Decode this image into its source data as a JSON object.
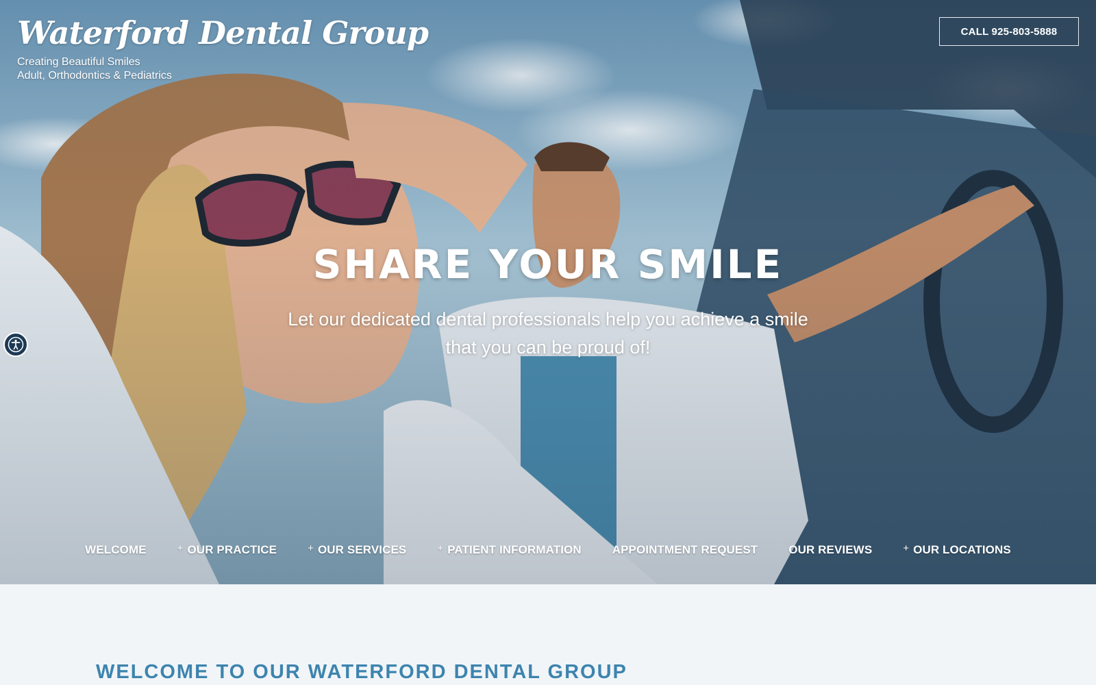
{
  "brand": {
    "title": "Waterford Dental Group",
    "tagline_1": "Creating Beautiful Smiles",
    "tagline_2": "Adult, Orthodontics & Pediatrics"
  },
  "header": {
    "call_label": "CALL 925-803-5888"
  },
  "hero": {
    "heading": "SHARE YOUR SMILE",
    "subheading": "Let our dedicated dental professionals help you achieve a smile that you can be proud of!",
    "image_icon": "hero-photo"
  },
  "nav": {
    "items": [
      {
        "label": "WELCOME",
        "has_submenu": false
      },
      {
        "label": "OUR PRACTICE",
        "has_submenu": true
      },
      {
        "label": "OUR SERVICES",
        "has_submenu": true
      },
      {
        "label": "PATIENT INFORMATION",
        "has_submenu": true
      },
      {
        "label": "APPOINTMENT REQUEST",
        "has_submenu": false
      },
      {
        "label": "OUR REVIEWS",
        "has_submenu": false
      },
      {
        "label": "OUR LOCATIONS",
        "has_submenu": true
      }
    ],
    "submenu_marker": "+"
  },
  "main": {
    "welcome_heading": "WELCOME TO OUR WATERFORD DENTAL GROUP"
  },
  "accessibility": {
    "icon": "accessibility-icon"
  },
  "colors": {
    "accent": "#3d84ae",
    "page_bg": "#f1f5f8",
    "a11y_bg": "#1d3a55"
  }
}
